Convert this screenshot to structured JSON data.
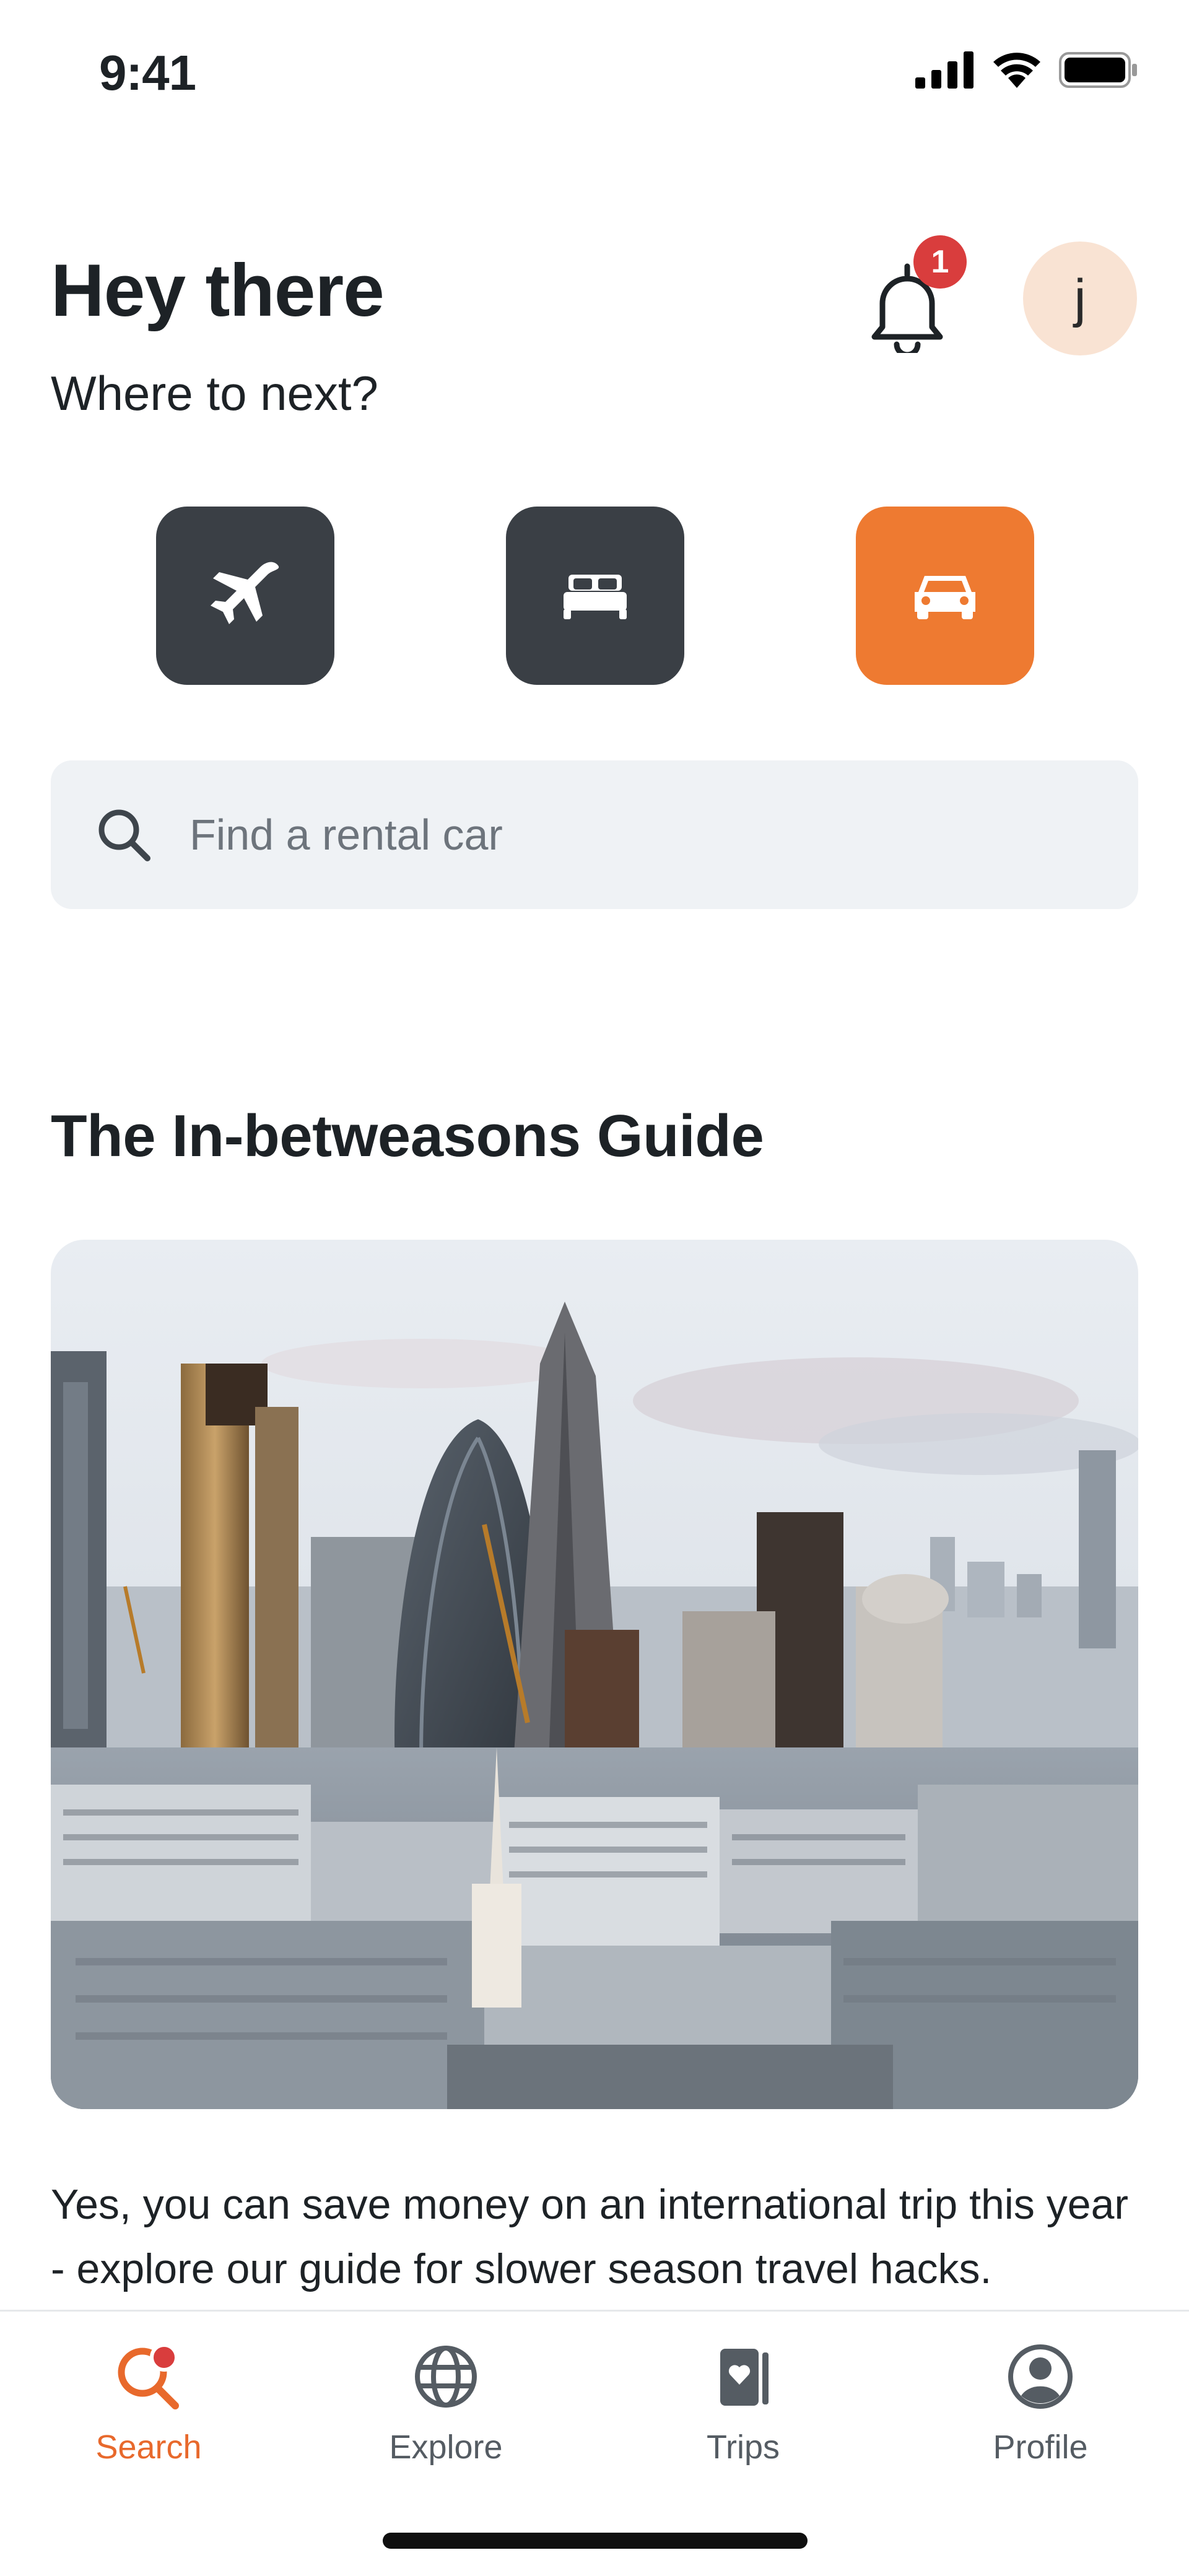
{
  "status_bar": {
    "time": "9:41"
  },
  "header": {
    "greeting": "Hey there",
    "subtitle": "Where to next?",
    "notification_count": "1",
    "avatar_initial": "j"
  },
  "categories": [
    {
      "name": "flights",
      "icon": "airplane-icon",
      "selected": false
    },
    {
      "name": "stays",
      "icon": "bed-icon",
      "selected": false
    },
    {
      "name": "cars",
      "icon": "car-icon",
      "selected": true
    }
  ],
  "search": {
    "placeholder": "Find a rental car",
    "value": ""
  },
  "guide": {
    "title": "The In-betweasons Guide",
    "description": "Yes, you can save money on an international trip this year - explore our guide for slower season travel hacks."
  },
  "nav": {
    "items": [
      {
        "label": "Search",
        "icon": "search-icon",
        "active": true
      },
      {
        "label": "Explore",
        "icon": "globe-icon",
        "active": false
      },
      {
        "label": "Trips",
        "icon": "trips-icon",
        "active": false
      },
      {
        "label": "Profile",
        "icon": "profile-icon",
        "active": false
      }
    ]
  },
  "colors": {
    "accent": "#ee7a31",
    "dark_button": "#3a3f45",
    "badge": "#d93d3d",
    "search_bg": "#eff2f5"
  }
}
